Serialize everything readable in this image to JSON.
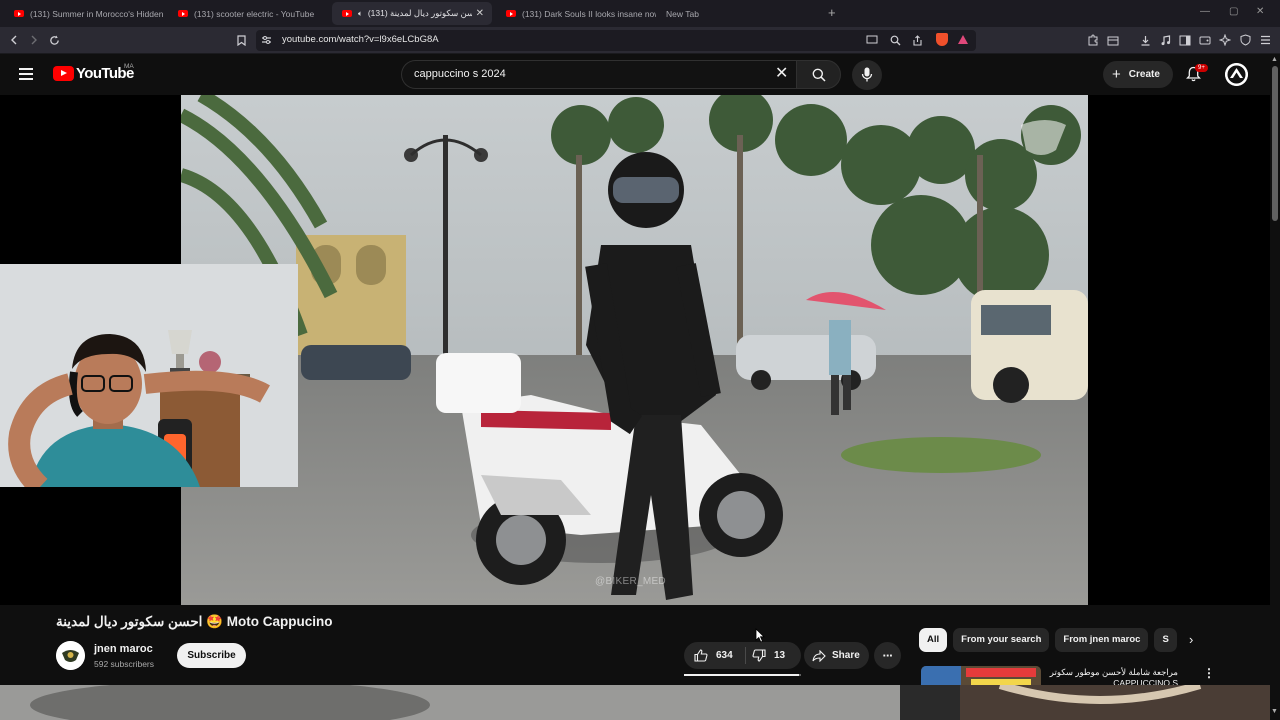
{
  "browser": {
    "tabs": [
      {
        "title": "(131) Summer in Morocco's Hidden"
      },
      {
        "title": "(131) scooter electric - YouTube"
      },
      {
        "title": "(131) احسن سكوتور ديال لمدينة",
        "active": true
      },
      {
        "title": "(131) Dark Souls II looks insane now"
      },
      {
        "title": "New Tab"
      }
    ],
    "url": "youtube.com/watch?v=l9x6eLCbG8A"
  },
  "youtube": {
    "logo_text": "YouTube",
    "region": "MA",
    "search_query": "cappuccino s 2024",
    "create_label": "Create",
    "notification_badge": "9+"
  },
  "video": {
    "watermark": "@BIKER_MED",
    "title": "احسن سكوتور ديال لمدينة 🤩 Moto Cappucino",
    "channel_name": "jnen maroc",
    "subscribers": "592 subscribers",
    "subscribe_label": "Subscribe",
    "likes": "634",
    "dislikes": "13",
    "like_ratio": 0.98,
    "share_label": "Share",
    "more_label": "···"
  },
  "sidebar": {
    "chips": [
      {
        "label": "All",
        "active": true
      },
      {
        "label": "From your search"
      },
      {
        "label": "From jnen maroc"
      },
      {
        "label": "S"
      }
    ],
    "recommendation": {
      "title": "مراجعة شاملة لأحسن موطور سكوتر CAPPUCCINO S"
    }
  },
  "colors": {
    "background": "#0f0f0f",
    "brand_red": "#ff0000",
    "chip_bg": "#272727",
    "text": "#f1f1f1"
  }
}
